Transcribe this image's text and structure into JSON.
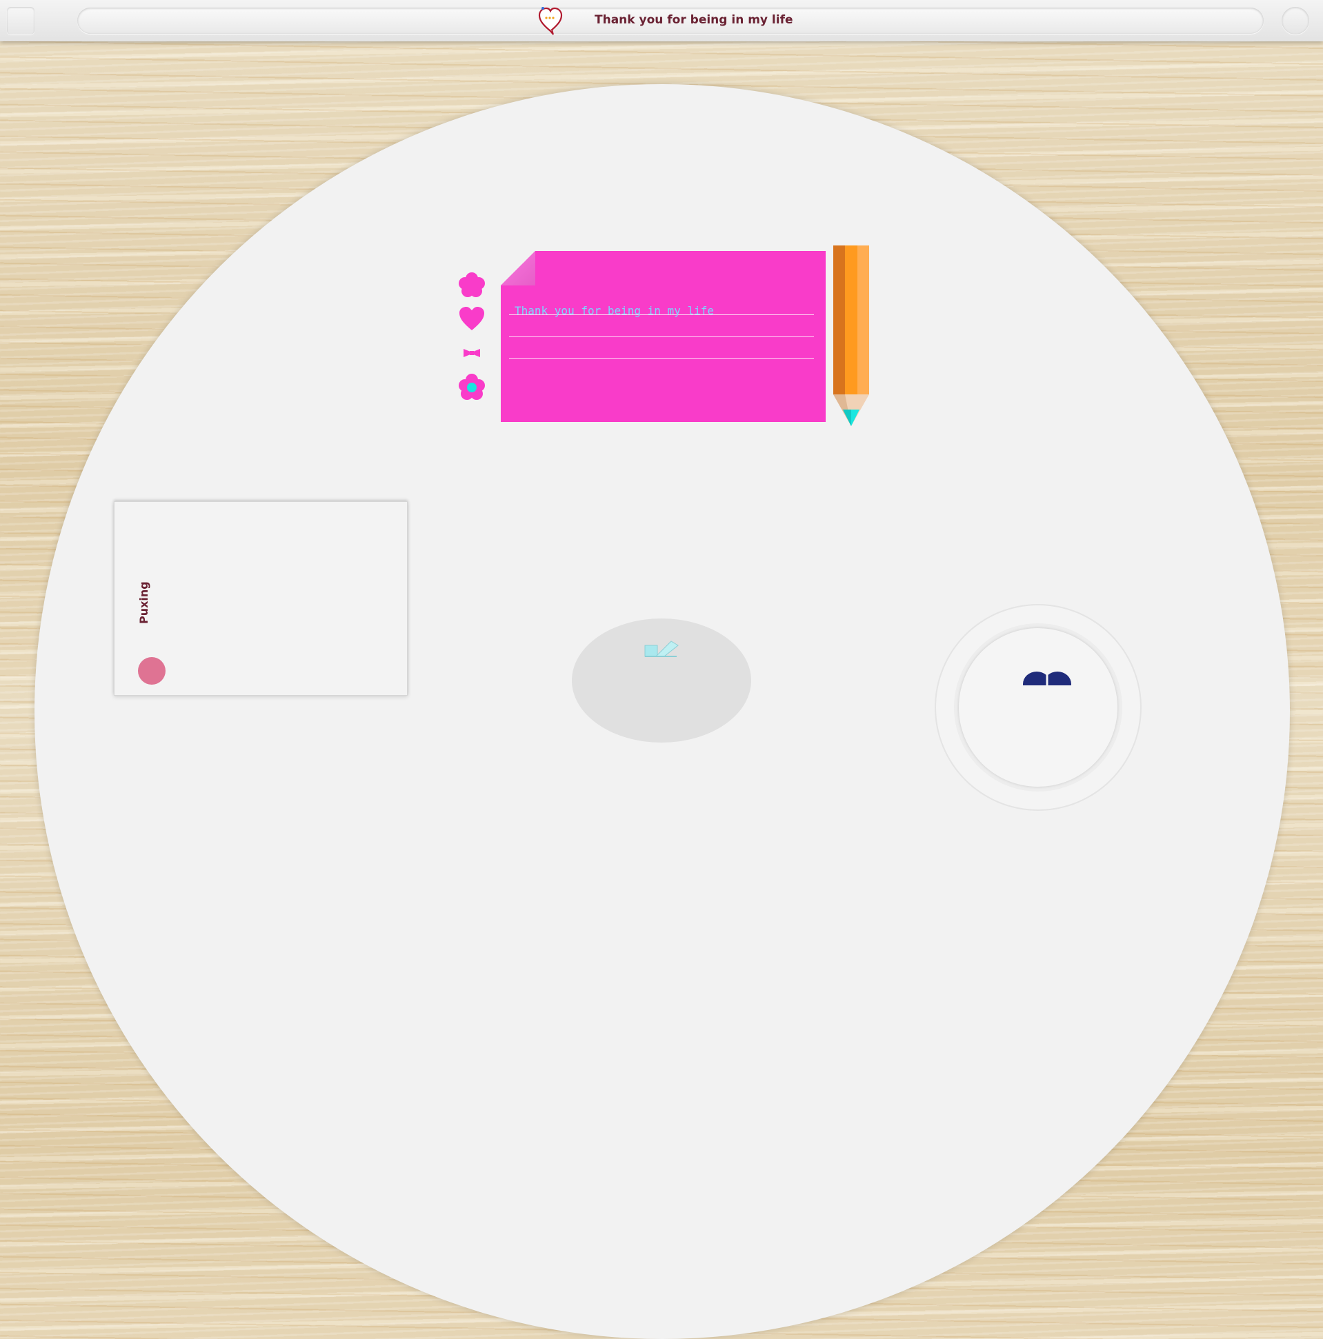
{
  "app": {
    "title": "Thank you for being in my life",
    "logo_icon": "heart-speech-bubble-icon"
  },
  "topbar": {
    "menu_button_icon": "square-menu-icon",
    "round_button_icon": "circle-icon"
  },
  "note": {
    "text": "Thank you for being in my life",
    "color": "#f93cc9",
    "text_color": "#7ad8ff",
    "line_count": 3
  },
  "tools": [
    {
      "name": "flower-shape-icon"
    },
    {
      "name": "heart-shape-icon"
    },
    {
      "name": "bow-shape-icon"
    },
    {
      "name": "cyan-center-flower-icon"
    }
  ],
  "pencil": {
    "color": "#ff9a1f",
    "tip_color": "#19e6e0"
  },
  "card": {
    "name": "Puxing",
    "dot_color": "#df7393"
  },
  "send": {
    "icon": "send-envelope-icon"
  },
  "plate": {
    "art_icon": "navy-figure-icon"
  },
  "colors": {
    "accent": "#f93cc9",
    "title_text": "#6a2233",
    "disc": "#f2f2f2"
  }
}
